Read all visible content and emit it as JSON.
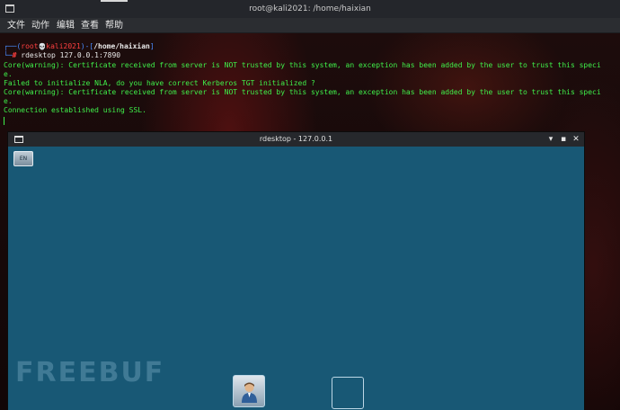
{
  "window": {
    "title": "root@kali2021: /home/haixian"
  },
  "menubar": {
    "items": [
      "文件",
      "动作",
      "编辑",
      "查看",
      "帮助"
    ]
  },
  "terminal": {
    "prompt": {
      "open": "┌──(",
      "user": "root",
      "skull": "💀",
      "host": "kali2021",
      "mid": ")-[",
      "path": "/home/haixian",
      "close": "]",
      "second_prefix": "└─",
      "hash": "#",
      "command": "rdesktop 127.0.0.1:7890"
    },
    "lines": [
      "Core(warning): Certificate received from server is NOT trusted by this system, an exception has been added by the user to trust this speci",
      "e.",
      "Failed to initialize NLA, do you have correct Kerberos TGT initialized ?",
      "Core(warning): Certificate received from server is NOT trusted by this system, an exception has been added by the user to trust this speci",
      "e.",
      "Connection established using SSL."
    ]
  },
  "rdesktop": {
    "title": "rdesktop - 127.0.0.1",
    "minimize": "▾",
    "maximize": "▪",
    "close": "✕",
    "keyboard_label": "EN"
  },
  "watermark": {
    "text": "FREEBUF"
  }
}
